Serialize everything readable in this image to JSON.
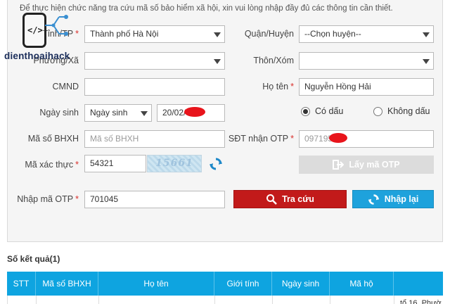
{
  "intro": "Để thực hiện chức năng tra cứu mã số bảo hiểm xã hội, xin vui lòng nhập đầy đủ các thông tin cần thiết.",
  "logo_text": "dienthoaihack",
  "form": {
    "province": {
      "label": "Tỉnh/TP",
      "value": "Thành phố Hà Nội"
    },
    "district": {
      "label": "Quận/Huyện",
      "value": "--Chọn huyện--"
    },
    "ward": {
      "label": "Phường/Xã",
      "value": ""
    },
    "village": {
      "label": "Thôn/Xóm",
      "value": ""
    },
    "id_card": {
      "label": "CMND",
      "value": ""
    },
    "full_name": {
      "label": "Họ tên",
      "value": "Nguyễn Hồng Hải"
    },
    "birth": {
      "label": "Ngày sinh",
      "type_value": "Ngày sinh",
      "value": "20/02/"
    },
    "accent_on": "Có dấu",
    "accent_off": "Không dấu",
    "bhxh": {
      "label": "Mã số BHXH",
      "placeholder": "Mã số BHXH"
    },
    "otp_phone": {
      "label": "SĐT nhận OTP",
      "value": "097195"
    },
    "captcha": {
      "label": "Mã xác thực",
      "value": "54321",
      "image_text": "15661"
    },
    "otp_code": {
      "label": "Nhập mã OTP",
      "value": "701045"
    },
    "required_mark": "*"
  },
  "buttons": {
    "get_otp": "Lấy mã OTP",
    "search": "Tra cứu",
    "reset": "Nhập lại"
  },
  "results": {
    "title": "Số kết quả(1)",
    "columns": [
      "STT",
      "Mã số BHXH",
      "Họ tên",
      "Giới tính",
      "Ngày sinh",
      "Mã hộ",
      ""
    ],
    "row_partial_address": "tổ 16, Phườ"
  },
  "colors": {
    "search_button": "#c21a1a",
    "reset_button": "#1ea2dc",
    "table_header": "#0ea4e0",
    "required": "#d9302c"
  }
}
